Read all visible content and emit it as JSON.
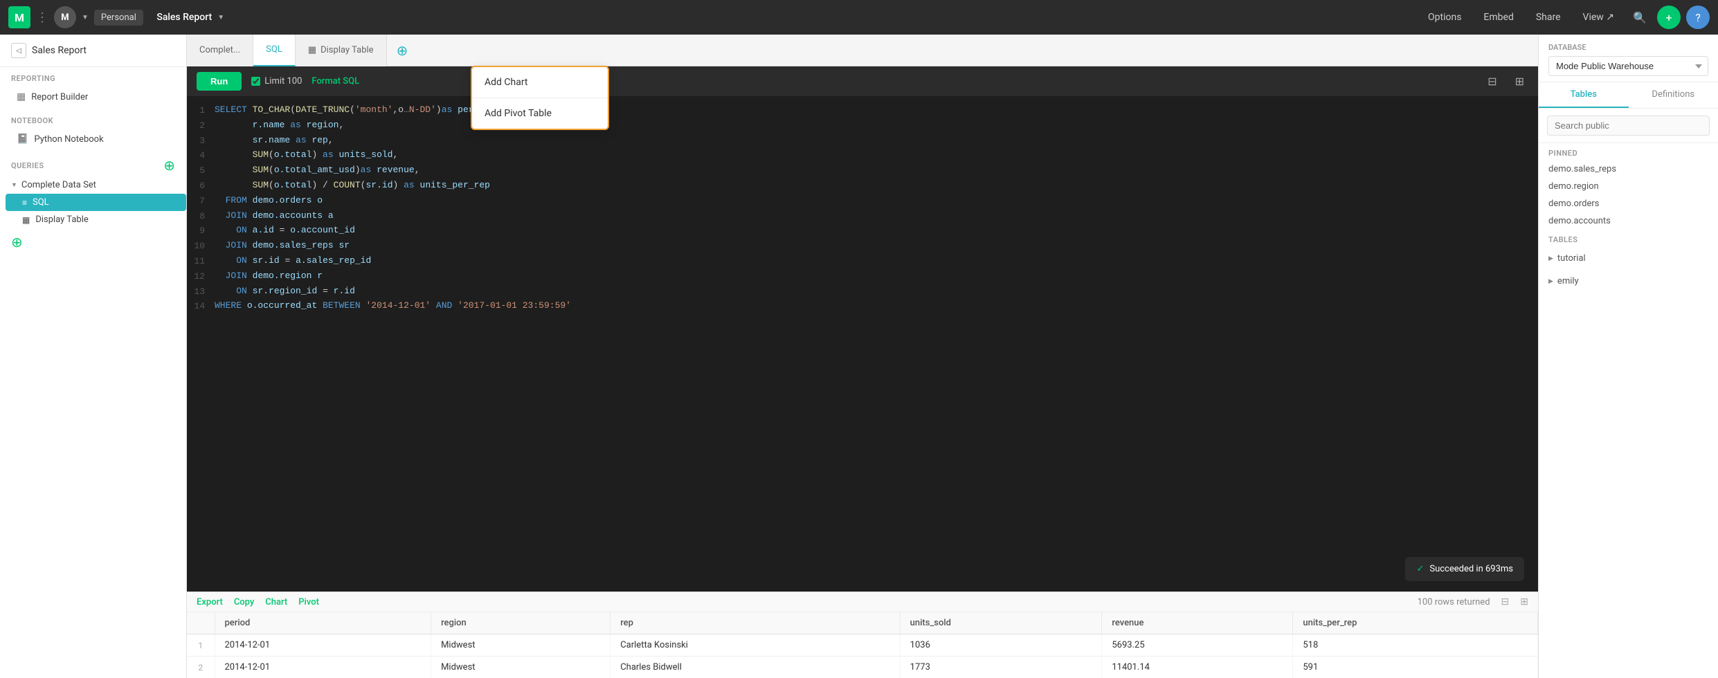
{
  "topnav": {
    "logo": "M",
    "personal_label": "Personal",
    "report_title": "Sales Report",
    "options_label": "Options",
    "embed_label": "Embed",
    "share_label": "Share",
    "view_label": "View ↗"
  },
  "sidebar": {
    "report_title": "Sales Report",
    "sections": {
      "reporting": "REPORTING",
      "notebook": "NOTEBOOK",
      "queries": "QUERIES"
    },
    "reporting_items": [
      {
        "label": "Report Builder",
        "icon": "▦"
      }
    ],
    "notebook_items": [
      {
        "label": "Python Notebook",
        "icon": "📓"
      }
    ],
    "query_groups": [
      {
        "label": "Complete Data Set",
        "expanded": true,
        "items": [
          {
            "label": "SQL",
            "icon": "≡",
            "active": true
          },
          {
            "label": "Display Table",
            "icon": "▦",
            "active": false
          }
        ]
      }
    ]
  },
  "tabs": [
    {
      "label": "Complet...",
      "active": false
    },
    {
      "label": "SQL",
      "active": true
    },
    {
      "label": "Display Table",
      "active": false,
      "icon": "▦"
    }
  ],
  "toolbar": {
    "run_label": "Run",
    "limit_label": "Limit 100",
    "format_label": "Format SQL"
  },
  "code_lines": [
    {
      "num": 1,
      "code": "SELECT TO_CHAR(DATE_TRUNC('month',o",
      "suffix": "N-DD')as period,"
    },
    {
      "num": 2,
      "code": "       r.name as region,"
    },
    {
      "num": 3,
      "code": "       sr.name as rep,"
    },
    {
      "num": 4,
      "code": "       SUM(o.total) as units_sold,"
    },
    {
      "num": 5,
      "code": "       SUM(o.total_amt_usd)as revenue,"
    },
    {
      "num": 6,
      "code": "       SUM(o.total) / COUNT(sr.id) as units_per_rep"
    },
    {
      "num": 7,
      "code": "  FROM demo.orders o"
    },
    {
      "num": 8,
      "code": "  JOIN demo.accounts a"
    },
    {
      "num": 9,
      "code": "    ON a.id = o.account_id"
    },
    {
      "num": 10,
      "code": "  JOIN demo.sales_reps sr"
    },
    {
      "num": 11,
      "code": "    ON sr.id = a.sales_rep_id"
    },
    {
      "num": 12,
      "code": "  JOIN demo.region r"
    },
    {
      "num": 13,
      "code": "    ON sr.region_id = r.id"
    },
    {
      "num": 14,
      "code": "WHERE o.occurred_at BETWEEN '2014-12-01' AND '2017-01-01 23:59:59'"
    }
  ],
  "results": {
    "export_label": "Export",
    "copy_label": "Copy",
    "chart_label": "Chart",
    "pivot_label": "Pivot",
    "rows_label": "100 rows returned"
  },
  "table": {
    "columns": [
      "",
      "period",
      "region",
      "rep",
      "units_sold",
      "revenue",
      "units_per_rep"
    ],
    "rows": [
      [
        "1",
        "2014-12-01",
        "Midwest",
        "Carletta Kosinski",
        "1036",
        "5693.25",
        "518"
      ],
      [
        "2",
        "2014-12-01",
        "Midwest",
        "Charles Bidwell",
        "1773",
        "11401.14",
        "591"
      ]
    ]
  },
  "success_toast": "Succeeded in 693ms",
  "right_sidebar": {
    "db_label": "Database",
    "db_value": "Mode Public Warehouse",
    "tabs": [
      "Tables",
      "Definitions"
    ],
    "search_placeholder": "Search public",
    "pinned_label": "PINNED",
    "pinned_items": [
      "demo.sales_reps",
      "demo.region",
      "demo.orders",
      "demo.accounts"
    ],
    "tables_label": "TABLES",
    "table_groups": [
      "tutorial",
      "emily"
    ]
  },
  "dropdown": {
    "items": [
      "Add Chart",
      "Add Pivot Table"
    ]
  }
}
